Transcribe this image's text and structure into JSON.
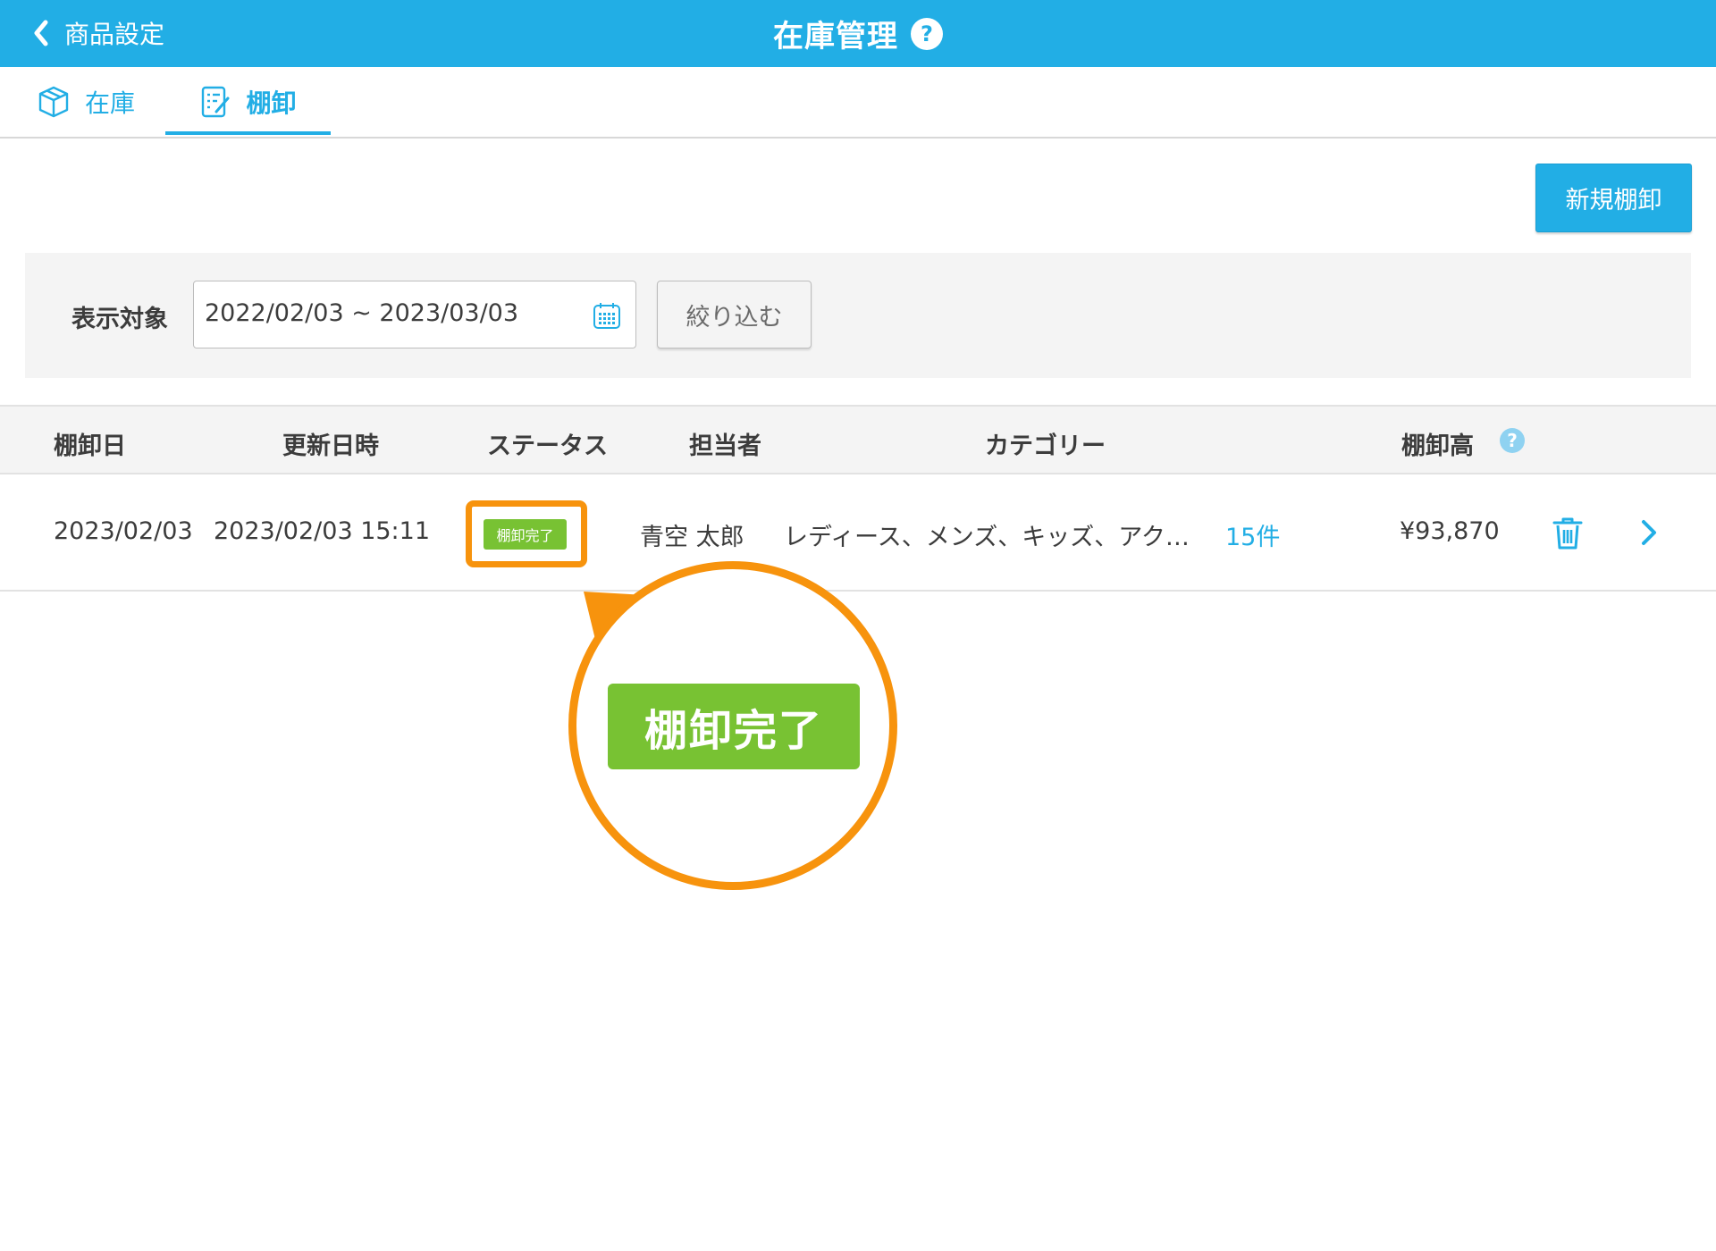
{
  "header": {
    "back_label": "商品設定",
    "title": "在庫管理",
    "help": "?",
    "background_color": "#22aee5"
  },
  "tabs": [
    {
      "label": "在庫",
      "icon": "box-icon",
      "active": false
    },
    {
      "label": "棚卸",
      "icon": "checklist-edit-icon",
      "active": true
    }
  ],
  "toolbar": {
    "new_button_label": "新規棚卸"
  },
  "filter": {
    "label": "表示対象",
    "date_range": "2022/02/03 ~ 2023/03/03",
    "calendar_icon": "calendar-icon",
    "apply_button_label": "絞り込む"
  },
  "table": {
    "columns": [
      "棚卸日",
      "更新日時",
      "ステータス",
      "担当者",
      "カテゴリー",
      "棚卸高"
    ],
    "amount_help": "?",
    "rows": [
      {
        "date": "2023/02/03",
        "updated": "2023/02/03 15:11",
        "status": "棚卸完了",
        "person": "青空 太郎",
        "categories": "レディース、メンズ、キッズ、アク…",
        "count": "15件",
        "amount": "¥93,870",
        "delete_icon": "trash-icon",
        "open_icon": "chevron-right-icon"
      }
    ]
  },
  "callout": {
    "label": "棚卸完了",
    "border_color": "#f7930d",
    "badge_color": "#78c233"
  }
}
